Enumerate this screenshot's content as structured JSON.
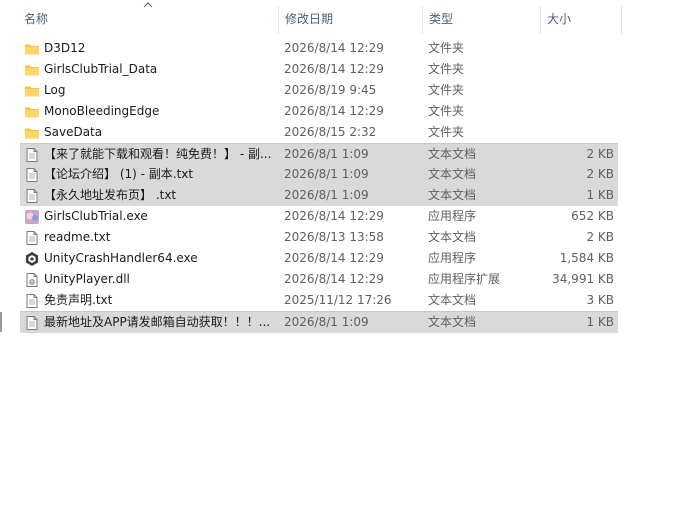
{
  "columns": {
    "name": "名称",
    "modified": "修改日期",
    "type": "类型",
    "size": "大小"
  },
  "files": [
    {
      "name": "D3D12",
      "modified": "2026/8/14 12:29",
      "type": "文件夹",
      "size": "",
      "icon": "folder-icon",
      "selected": false
    },
    {
      "name": "GirlsClubTrial_Data",
      "modified": "2026/8/14 12:29",
      "type": "文件夹",
      "size": "",
      "icon": "folder-icon",
      "selected": false
    },
    {
      "name": "Log",
      "modified": "2026/8/19 9:45",
      "type": "文件夹",
      "size": "",
      "icon": "folder-icon",
      "selected": false
    },
    {
      "name": "MonoBleedingEdge",
      "modified": "2026/8/14 12:29",
      "type": "文件夹",
      "size": "",
      "icon": "folder-icon",
      "selected": false
    },
    {
      "name": "SaveData",
      "modified": "2026/8/15 2:32",
      "type": "文件夹",
      "size": "",
      "icon": "folder-icon",
      "selected": false
    },
    {
      "name": "【来了就能下载和观看！纯免费！】 - 副...",
      "modified": "2026/8/1 1:09",
      "type": "文本文档",
      "size": "2 KB",
      "icon": "text-file-icon",
      "selected": true
    },
    {
      "name": "【论坛介绍】 (1) - 副本.txt",
      "modified": "2026/8/1 1:09",
      "type": "文本文档",
      "size": "2 KB",
      "icon": "text-file-icon",
      "selected": true
    },
    {
      "name": "【永久地址发布页】 .txt",
      "modified": "2026/8/1 1:09",
      "type": "文本文档",
      "size": "1 KB",
      "icon": "text-file-icon",
      "selected": true
    },
    {
      "name": "GirlsClubTrial.exe",
      "modified": "2026/8/14 12:29",
      "type": "应用程序",
      "size": "652 KB",
      "icon": "app-exe-icon",
      "selected": false
    },
    {
      "name": "readme.txt",
      "modified": "2026/8/13 13:58",
      "type": "文本文档",
      "size": "2 KB",
      "icon": "text-file-icon",
      "selected": false
    },
    {
      "name": "UnityCrashHandler64.exe",
      "modified": "2026/8/14 12:29",
      "type": "应用程序",
      "size": "1,584 KB",
      "icon": "unity-icon",
      "selected": false
    },
    {
      "name": "UnityPlayer.dll",
      "modified": "2026/8/14 12:29",
      "type": "应用程序扩展",
      "size": "34,991 KB",
      "icon": "dll-file-icon",
      "selected": false
    },
    {
      "name": "免责声明.txt",
      "modified": "2025/11/12 17:26",
      "type": "文本文档",
      "size": "3 KB",
      "icon": "text-file-icon",
      "selected": false
    },
    {
      "name": "最新地址及APP请发邮箱自动获取！！！...",
      "modified": "2026/8/1 1:09",
      "type": "文本文档",
      "size": "1 KB",
      "icon": "text-file-icon",
      "selected": true
    }
  ]
}
